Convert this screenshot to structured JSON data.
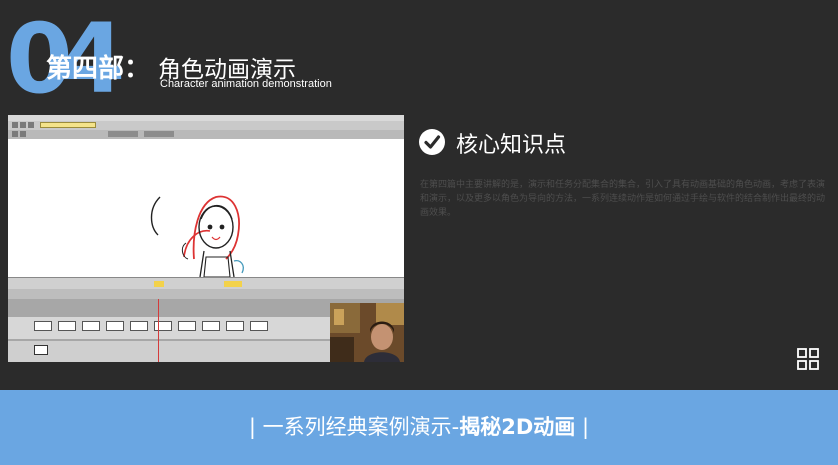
{
  "header": {
    "number": "04",
    "title_bold": "第四部：",
    "title_light": "角色动画演示",
    "subtitle": "Character animation demonstration"
  },
  "panel": {
    "heading": "核心知识点",
    "description": "在第四篇中主要讲解的是，演示和任务分配集合的集合，引入了具有动画基础的角色动画，考虑了表演和演示，以及更多以角色为导向的方法，一系列连续动作是如何通过手绘与软件的结合制作出最终的动画效果。"
  },
  "footer": {
    "prefix": "| 一系列经典案例演示-",
    "bold": "揭秘2D动画",
    "suffix": " |"
  },
  "colors": {
    "accent": "#6aa6e2",
    "background": "#2b2b2b"
  },
  "icons": [
    "check-circle-icon",
    "grid-icon"
  ]
}
